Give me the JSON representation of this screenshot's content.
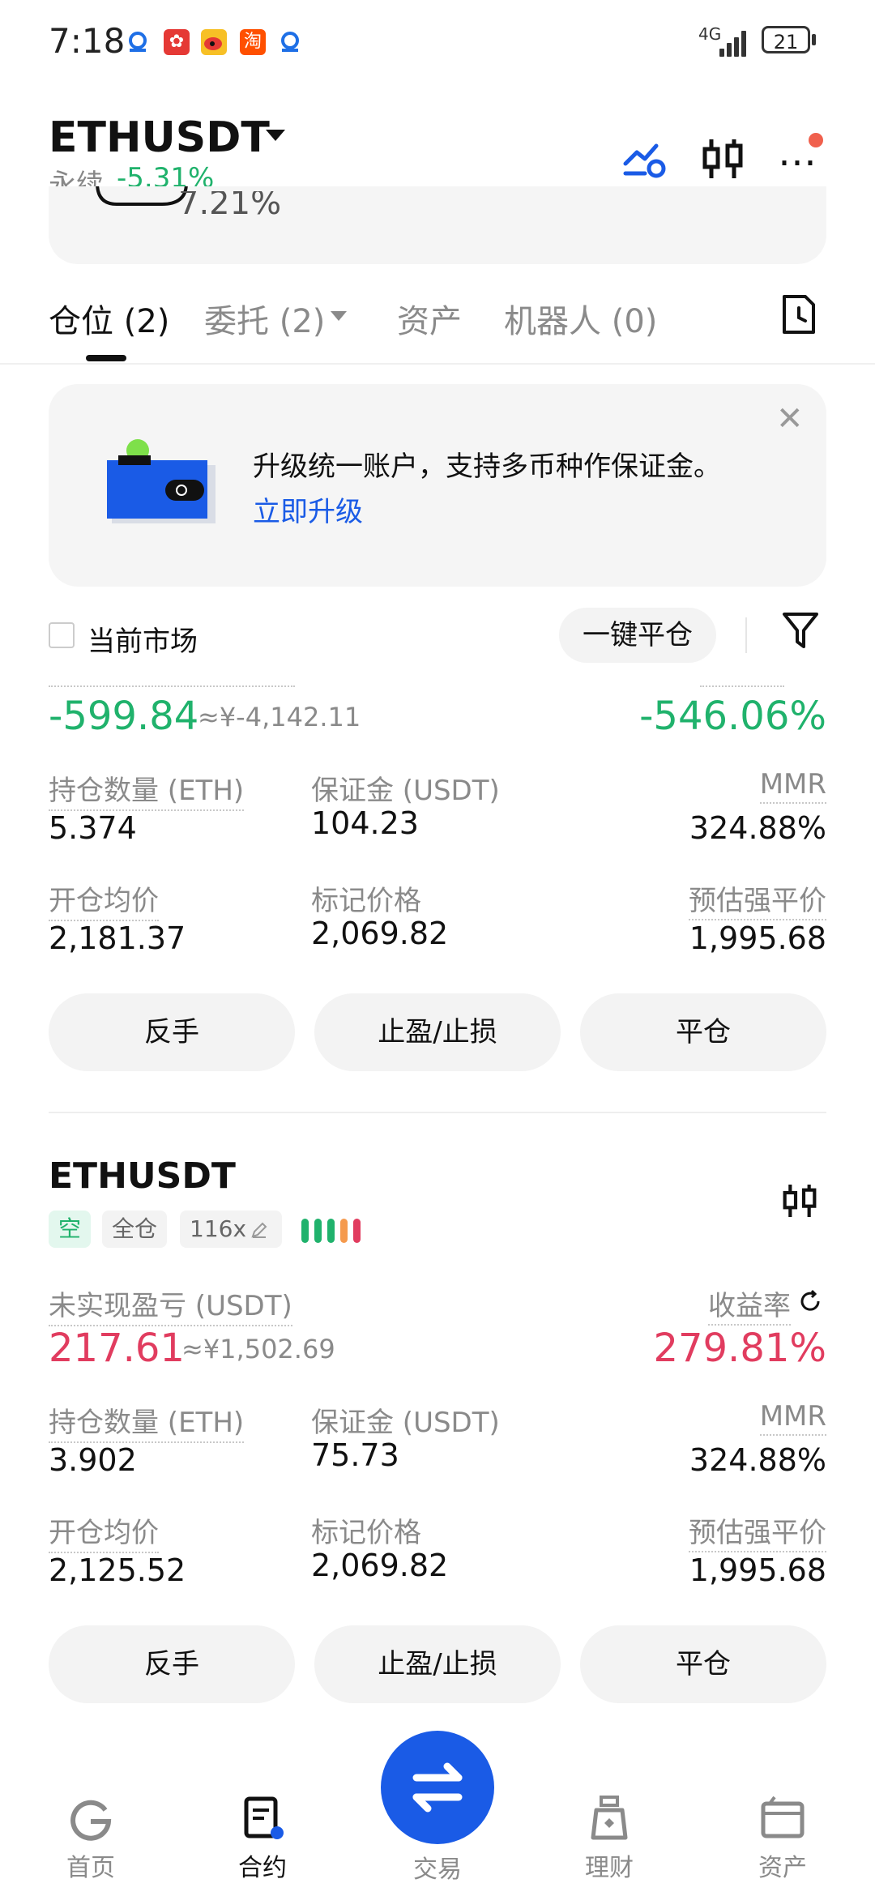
{
  "status_bar": {
    "time": "7:18",
    "network": "4G",
    "battery": "21",
    "app_icons": [
      "app-blue-icon",
      "huawei-icon",
      "weibo-icon",
      "taobao-icon",
      "app-blue-icon"
    ]
  },
  "header": {
    "symbol": "ETHUSDT",
    "contract_type": "永续",
    "change": "-5.31%"
  },
  "partial_card_text": "7.21%",
  "tabs": [
    {
      "label": "仓位 (2)",
      "active": true
    },
    {
      "label": "委托 (2)",
      "active": false
    },
    {
      "label": "资产",
      "active": false
    },
    {
      "label": "机器人 (0)",
      "active": false
    }
  ],
  "promo": {
    "text": "升级统一账户，支持多币种作保证金。",
    "link": "立即升级"
  },
  "filter": {
    "current_market": "当前市场",
    "close_all": "一键平仓"
  },
  "position1": {
    "pnl": "-599.84",
    "pnl_cny": "≈¥-4,142.11",
    "roe": "-546.06%",
    "qty_label": "持仓数量 (ETH)",
    "qty": "5.374",
    "margin_label": "保证金 (USDT)",
    "margin": "104.23",
    "mmr_label": "MMR",
    "mmr": "324.88%",
    "entry_label": "开仓均价",
    "entry": "2,181.37",
    "mark_label": "标记价格",
    "mark": "2,069.82",
    "liq_label": "预估强平价",
    "liq": "1,995.68"
  },
  "position2": {
    "symbol": "ETHUSDT",
    "side": "空",
    "margin_mode": "全仓",
    "leverage": "116x",
    "leverage_level": 5,
    "pnl_label": "未实现盈亏 (USDT)",
    "roe_label": "收益率",
    "pnl": "217.61",
    "pnl_cny": "≈¥1,502.69",
    "roe": "279.81%",
    "qty_label": "持仓数量 (ETH)",
    "qty": "3.902",
    "margin_label": "保证金 (USDT)",
    "margin": "75.73",
    "mmr_label": "MMR",
    "mmr": "324.88%",
    "entry_label": "开仓均价",
    "entry": "2,125.52",
    "mark_label": "标记价格",
    "mark": "2,069.82",
    "liq_label": "预估强平价",
    "liq": "1,995.68"
  },
  "actions": {
    "reverse": "反手",
    "tpsl": "止盈/止损",
    "close": "平仓"
  },
  "bottom_nav": {
    "home": "首页",
    "contract": "合约",
    "trade": "交易",
    "finance": "理财",
    "assets": "资产",
    "active": "contract"
  },
  "colors": {
    "green": "#20b26c",
    "red": "#e13c5f",
    "orange": "#f59a4d",
    "accent_blue": "#1a5be6"
  }
}
